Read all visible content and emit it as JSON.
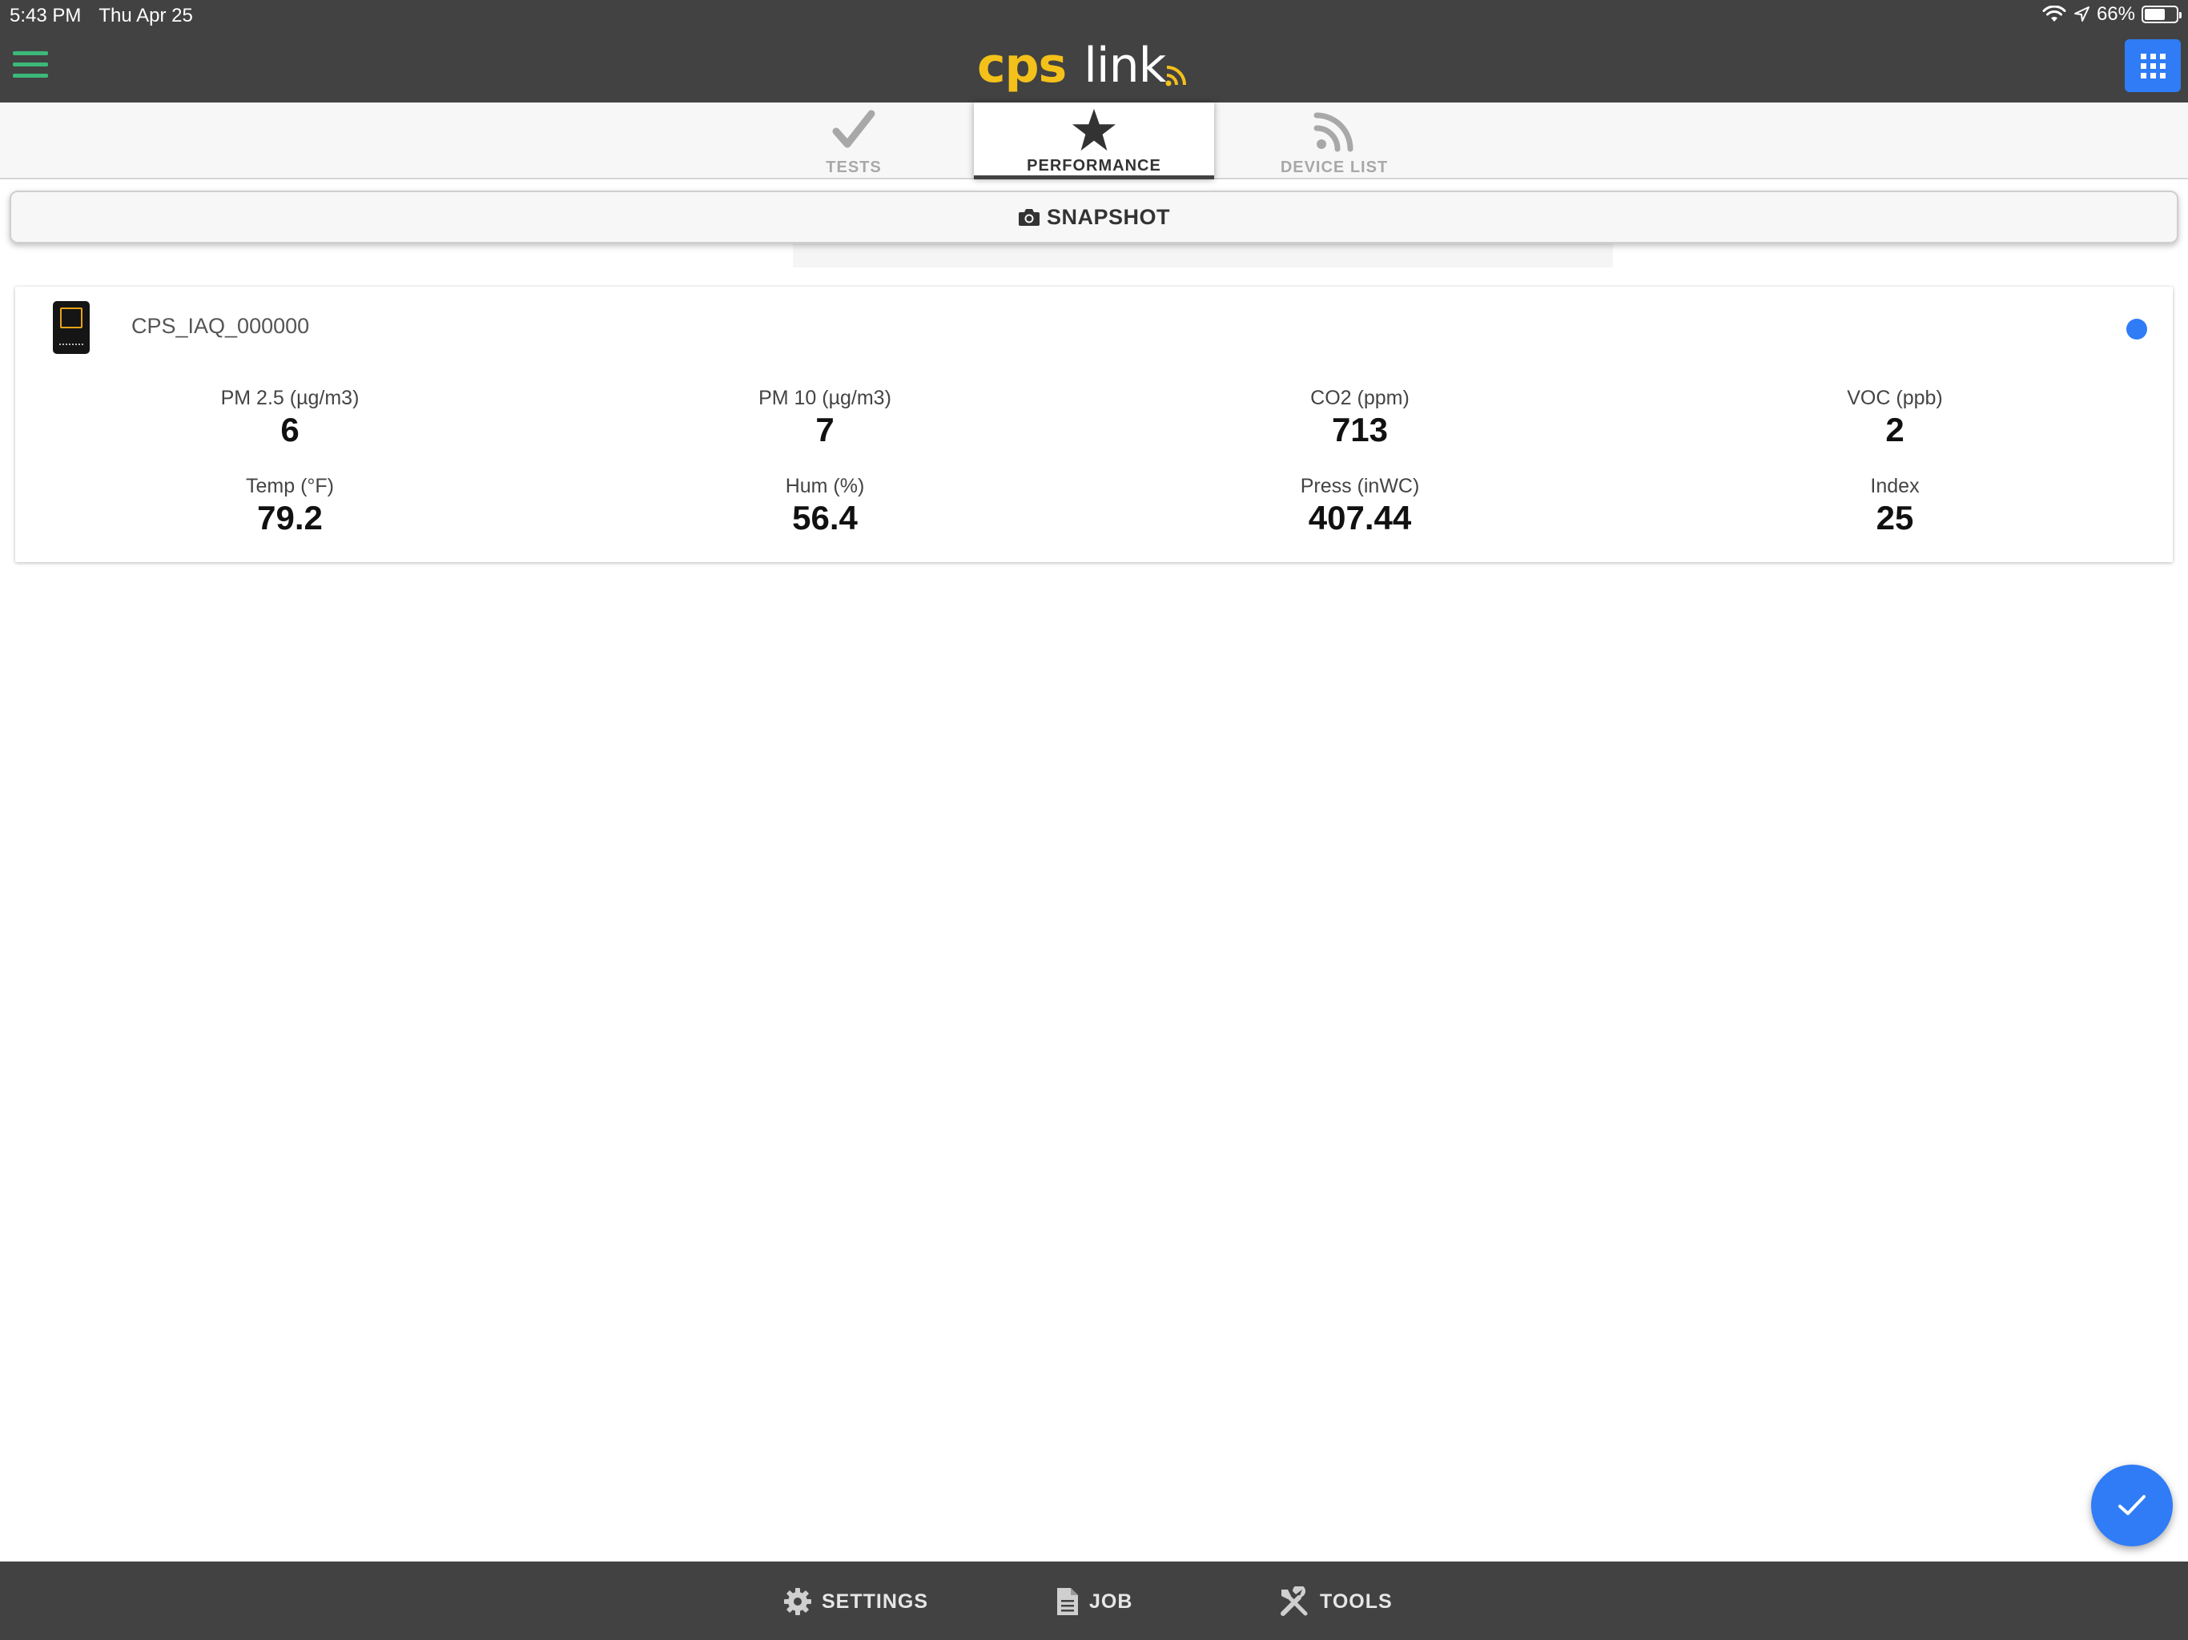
{
  "status_bar": {
    "time": "5:43 PM",
    "date": "Thu Apr 25",
    "battery": "66%",
    "battery_level": 0.66
  },
  "header": {
    "brand": "cps",
    "product": "link",
    "menu_icon": "hamburger-menu-icon",
    "apps_icon": "apps-grid-icon"
  },
  "tabs": [
    {
      "label": "TESTS",
      "icon": "checkmark-icon",
      "active": false
    },
    {
      "label": "PERFORMANCE",
      "icon": "star-icon",
      "active": true
    },
    {
      "label": "DEVICE LIST",
      "icon": "rss-feed-icon",
      "active": false
    }
  ],
  "snapshot": {
    "label": "SNAPSHOT",
    "icon": "camera-icon"
  },
  "device": {
    "name": "CPS_IAQ_000000",
    "status_color": "#2f7cf6",
    "metrics": [
      {
        "label": "PM 2.5 (µg/m3)",
        "value": "6"
      },
      {
        "label": "PM 10 (µg/m3)",
        "value": "7"
      },
      {
        "label": "CO2 (ppm)",
        "value": "713"
      },
      {
        "label": "VOC (ppb)",
        "value": "2"
      },
      {
        "label": "Temp (°F)",
        "value": "79.2"
      },
      {
        "label": "Hum (%)",
        "value": "56.4"
      },
      {
        "label": "Press (inWC)",
        "value": "407.44"
      },
      {
        "label": "Index",
        "value": "25"
      }
    ]
  },
  "fab": {
    "icon": "check-icon"
  },
  "bottom_nav": [
    {
      "label": "SETTINGS",
      "icon": "gear-icon"
    },
    {
      "label": "JOB",
      "icon": "document-icon"
    },
    {
      "label": "TOOLS",
      "icon": "tools-icon"
    }
  ],
  "colors": {
    "bar": "#424242",
    "accent": "#2f7cf6",
    "brand_yellow": "#f4c11a",
    "menu_green": "#3cb878"
  }
}
